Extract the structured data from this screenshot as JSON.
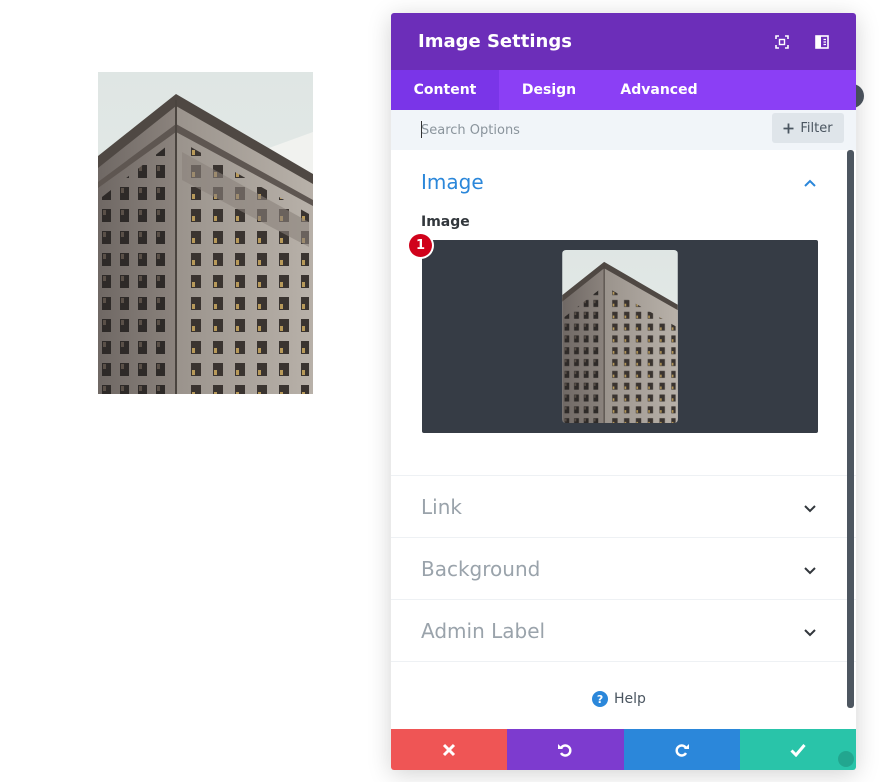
{
  "modal": {
    "title": "Image Settings",
    "tabs": [
      {
        "label": "Content",
        "active": true
      },
      {
        "label": "Design",
        "active": false
      },
      {
        "label": "Advanced",
        "active": false
      }
    ],
    "search": {
      "placeholder": "Search Options",
      "filter_label": "Filter"
    },
    "sections": {
      "image": {
        "title": "Image",
        "field_label": "Image",
        "badge": "1"
      },
      "link": {
        "title": "Link"
      },
      "background": {
        "title": "Background"
      },
      "admin_label": {
        "title": "Admin Label"
      }
    },
    "help_label": "Help"
  },
  "colors": {
    "header": "#6c2eb9",
    "tabs": "#8b3ff5",
    "accent_blue": "#2b87da",
    "cancel": "#ef5555",
    "undo": "#7d3bcf",
    "redo": "#2b87da",
    "save": "#29c4a9",
    "badge": "#d0021b"
  },
  "icons": {
    "fullscreen": "fullscreen-icon",
    "sidebar": "sidebar-toggle-icon",
    "cancel": "close-icon",
    "undo": "undo-icon",
    "redo": "redo-icon",
    "save": "check-icon"
  }
}
